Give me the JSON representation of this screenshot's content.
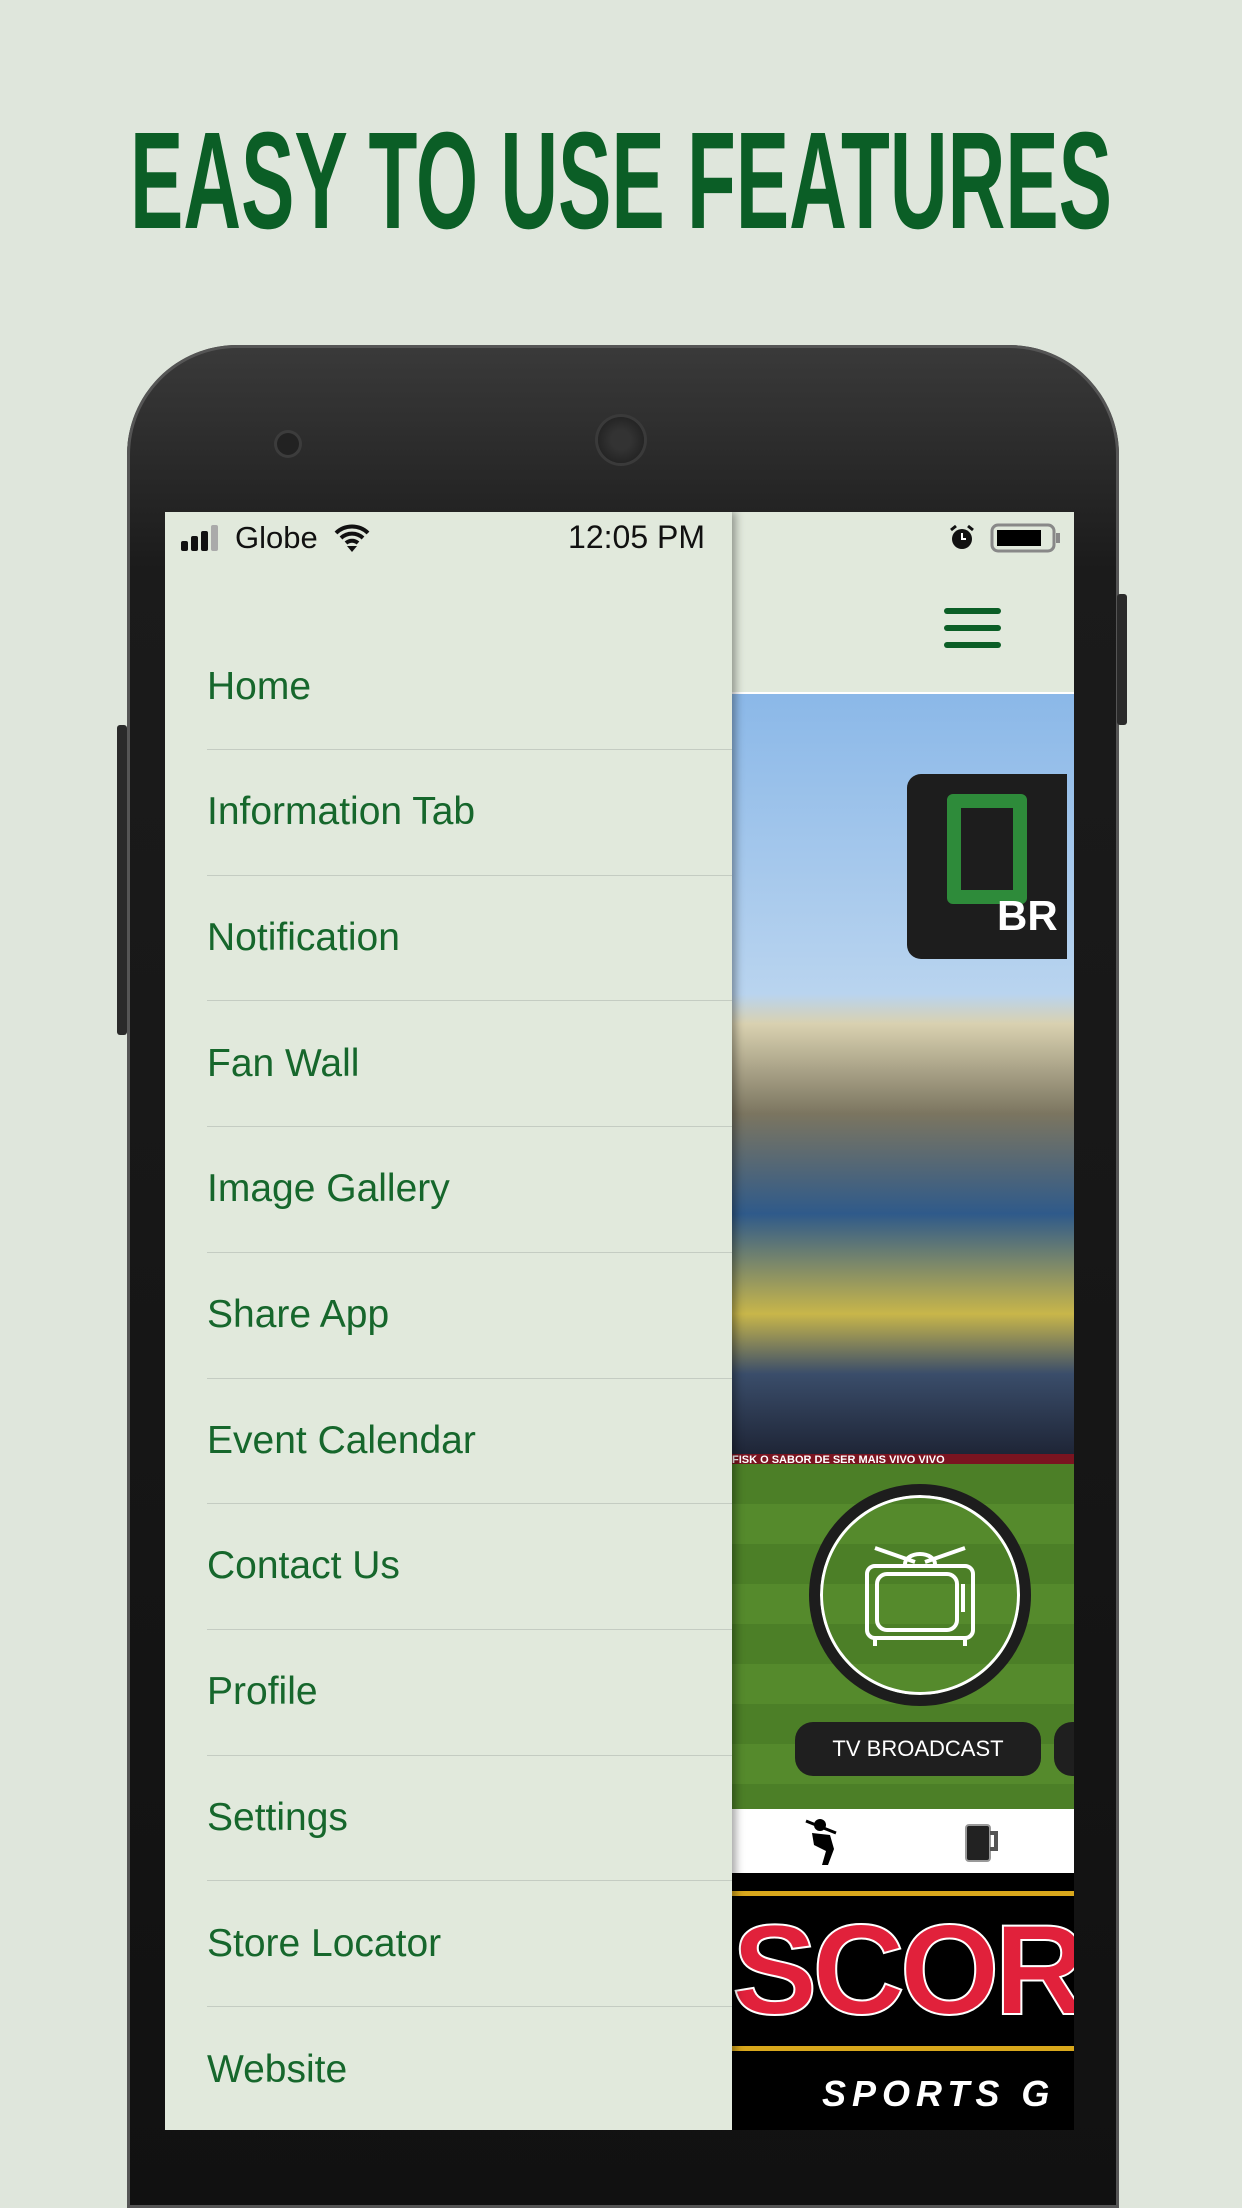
{
  "headline": "EASY TO USE FEATURES",
  "status": {
    "carrier": "Globe",
    "time": "12:05 PM"
  },
  "menu": [
    {
      "label": "Home"
    },
    {
      "label": "Information Tab"
    },
    {
      "label": "Notification"
    },
    {
      "label": "Fan Wall"
    },
    {
      "label": "Image Gallery"
    },
    {
      "label": "Share App"
    },
    {
      "label": "Event Calendar"
    },
    {
      "label": "Contact Us"
    },
    {
      "label": "Profile"
    },
    {
      "label": "Settings"
    },
    {
      "label": "Store Locator"
    },
    {
      "label": "Website"
    }
  ],
  "app": {
    "logo_text": "BR",
    "ad_band": "FISK  O SABOR DE SER MAIS  VIVO  VIVO",
    "tile_label": "TV BROADCAST",
    "tile_icon": "tv-icon",
    "banner_title": "SCORE",
    "banner_sub": "SPORTS G"
  },
  "colors": {
    "brand_green": "#0b5e26",
    "background": "#dfe6dc"
  }
}
